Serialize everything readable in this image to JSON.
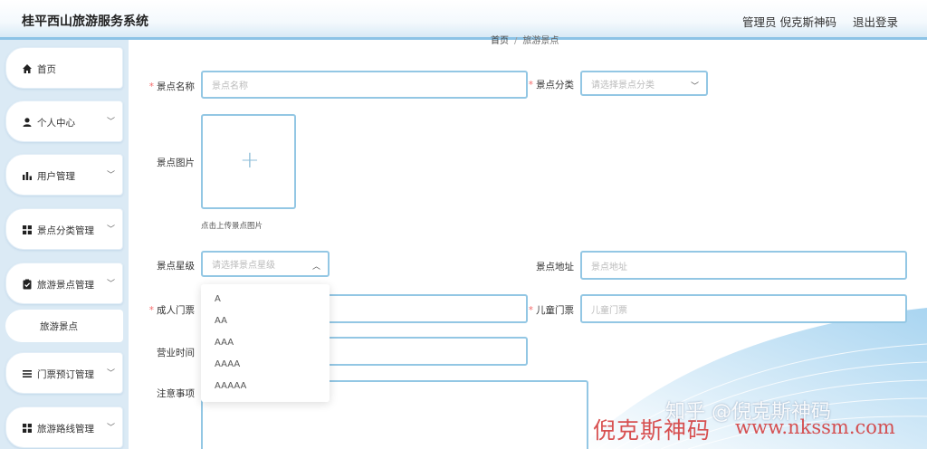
{
  "header": {
    "title": "桂平西山旅游服务系统",
    "user": "管理员 倪克斯神码",
    "logout": "退出登录"
  },
  "sidebar": {
    "items": [
      {
        "label": "首页",
        "icon": "home-icon"
      },
      {
        "label": "个人中心",
        "icon": "user-icon"
      },
      {
        "label": "用户管理",
        "icon": "bar-chart-icon"
      },
      {
        "label": "景点分类管理",
        "icon": "grid-icon"
      },
      {
        "label": "旅游景点管理",
        "icon": "clipboard-icon"
      },
      {
        "label": "门票预订管理",
        "icon": "list-icon"
      },
      {
        "label": "旅游路线管理",
        "icon": "grid-icon"
      }
    ],
    "sub_item": "旅游景点"
  },
  "breadcrumb": {
    "home": "首页",
    "sep": "/",
    "current": "旅游景点"
  },
  "form": {
    "name_label": "景点名称",
    "name_placeholder": "景点名称",
    "category_label": "景点分类",
    "category_placeholder": "请选择景点分类",
    "image_label": "景点图片",
    "upload_tip": "点击上传景点图片",
    "star_label": "景点星级",
    "star_placeholder": "请选择景点星级",
    "star_options": [
      "A",
      "AA",
      "AAA",
      "AAAA",
      "AAAAA"
    ],
    "address_label": "景点地址",
    "address_placeholder": "景点地址",
    "adult_label": "成人门票",
    "child_label": "儿童门票",
    "child_placeholder": "儿童门票",
    "hours_label": "营业时间",
    "notes_label": "注意事项",
    "required_mark": "*"
  },
  "watermark": {
    "zhihu": "知乎 @倪克斯神码",
    "text": "倪克斯神码",
    "url": "www.nkssm.com"
  },
  "colors": {
    "accent_border": "#93c7e4",
    "sidebar_bg": "#dbeaf5",
    "required": "#f56c6c"
  }
}
